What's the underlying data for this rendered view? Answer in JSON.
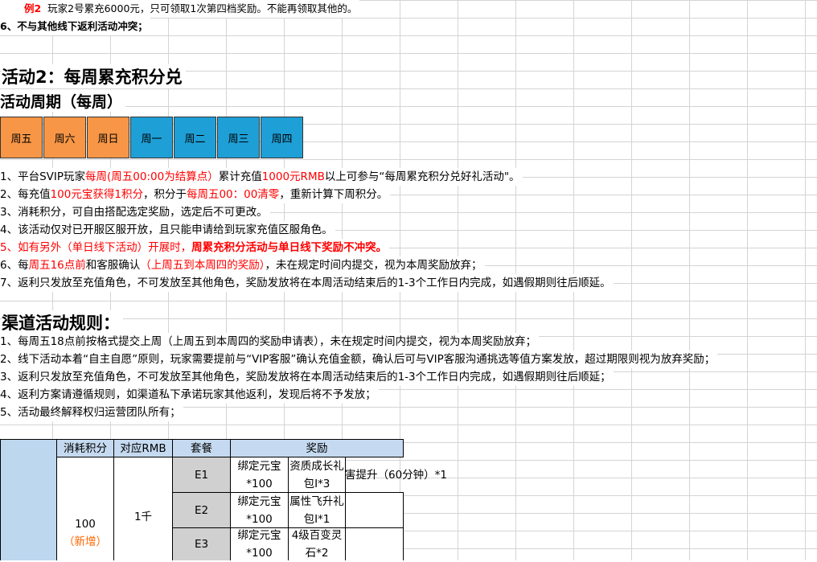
{
  "top": {
    "example_label": "例2",
    "example_text": "玩家2号累充6000元，只可领取1次第四档奖励。不能再领取其他的。",
    "rule6": "6、不与其他线下返利活动冲突；"
  },
  "activity": {
    "title": "活动2：每周累充积分兑",
    "period_title": "活动周期（每周）"
  },
  "week": [
    "周五",
    "周六",
    "周日",
    "周一",
    "周二",
    "周三",
    "周四"
  ],
  "rules": {
    "r1": {
      "a": "1、平台SVIP玩家",
      "b": "每周(周五00:00为结算点）",
      "c": "累计充值",
      "d": "1000元RMB",
      "e": "以上可参与“每周累充积分兑好礼活动\"。"
    },
    "r2": {
      "a": "2、每充值",
      "b": "100元宝获得1积分",
      "c": "，积分于",
      "d": "每周五00：00清零",
      "e": "，重新计算下周积分。"
    },
    "r3": "3、消耗积分，可自由搭配选定奖励，选定后不可更改。",
    "r4": "4、该活动仅对已开服区服开放，且只能申请给到玩家充值区服角色。",
    "r5": {
      "a": "5、如有另外（单日线下活动）开展时，",
      "b": "周累充积分活动与单日线下奖励不冲突。"
    },
    "r6": {
      "a": "6、每",
      "b": "周五16点前",
      "c": "和客服确认",
      "d": "（上周五到本周四的奖励）",
      "e": "，未在规定时间内提交，视为本周奖励放弃；"
    },
    "r7": "7、返利只发放至充值角色，不可发放至其他角色，奖励发放将在本周活动结束后的1-3个工作日内完成，如遇假期则往后顺延。"
  },
  "channel": {
    "title": "渠道活动规则：",
    "rules": [
      "1、每周五18点前按格式提交上周（上周五到本周四的奖励申请表），未在规定时间内提交，视为本周奖励放弃；",
      "2、线下活动本着“自主自愿”原则，玩家需要提前与“VIP客服”确认充值金额，确认后可与VIP客服沟通挑选等值方案发放，超过期限则视为放弃奖励；",
      "3、返利只发放至充值角色，不可发放至其他角色，奖励发放将在本周活动结束后的1-3个工作日内完成，如遇假期则往后顺延；",
      "4、返利方案请遵循规则，如渠道私下承诺玩家其他返利，发现后将不予发放；",
      "5、活动最终解释权归运营团队所有；"
    ]
  },
  "table": {
    "headers": [
      "消耗积分",
      "对应RMB",
      "套餐",
      "奖励"
    ],
    "points": {
      "value": "100",
      "note": "（新增）"
    },
    "rmb": "1千",
    "rows": [
      {
        "pkg": "E1",
        "a": "绑定元宝*100",
        "b": "资质成长礼包I*3",
        "c": "害提升（60分钟）*1"
      },
      {
        "pkg": "E2",
        "a": "绑定元宝*100",
        "b": "属性飞升礼包I*1"
      },
      {
        "pkg": "E3",
        "a": "绑定元宝*100",
        "b": "4级百变灵石*2"
      }
    ]
  }
}
